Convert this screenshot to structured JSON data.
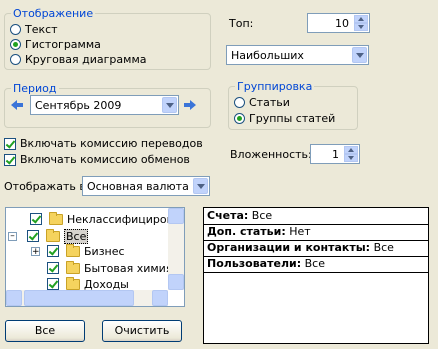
{
  "display": {
    "title": "Отображение",
    "options": [
      "Текст",
      "Гистограмма",
      "Круговая диаграмма"
    ],
    "selected_index": 1
  },
  "top": {
    "label": "Топ:",
    "value": "10"
  },
  "order": {
    "value": "Наибольших"
  },
  "period": {
    "title": "Период",
    "value": "Сентябрь 2009"
  },
  "grouping": {
    "title": "Группировка",
    "options": [
      "Статьи",
      "Группы статей"
    ],
    "selected_index": 1
  },
  "checkboxes": {
    "transfer_fee": {
      "label": "Включать комиссию переводов",
      "checked": true
    },
    "exchange_fee": {
      "label": "Включать комиссию обменов",
      "checked": true
    }
  },
  "nesting": {
    "label": "Вложенность:",
    "value": "1"
  },
  "show_in": {
    "label": "Отображать в:",
    "value": "Основная валюта"
  },
  "tree": {
    "items": [
      {
        "label": "Неклассифицирован",
        "checked": true
      },
      {
        "label": "Все",
        "checked": true,
        "selected": true
      },
      {
        "label": "Бизнес",
        "checked": true
      },
      {
        "label": "Бытовая химия",
        "checked": true
      },
      {
        "label": "Доходы",
        "checked": true
      }
    ]
  },
  "buttons": {
    "all": "Все",
    "clear": "Очистить"
  },
  "summary": [
    {
      "key": "Счета:",
      "value": "Все"
    },
    {
      "key": "Доп. статьи:",
      "value": "Нет"
    },
    {
      "key": "Организации и контакты:",
      "value": "Все"
    },
    {
      "key": "Пользователи:",
      "value": "Все"
    }
  ],
  "colors": {
    "group_title": "#0046d5",
    "check": "#21a121",
    "nav_arrow": "#3a74d8"
  }
}
